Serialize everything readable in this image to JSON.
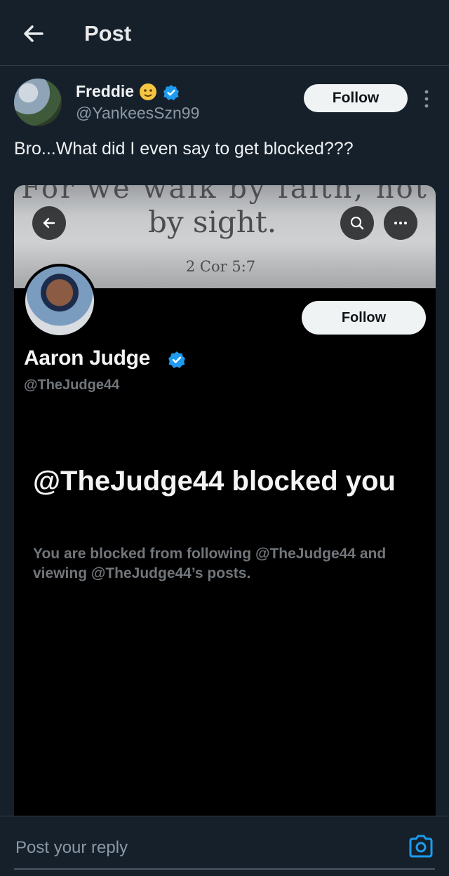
{
  "header": {
    "title": "Post"
  },
  "post": {
    "author_name": "Freddie",
    "author_handle": "@YankeesSzn99",
    "follow_label": "Follow",
    "text": "Bro...What did I even say to get blocked???"
  },
  "embedded_screenshot": {
    "banner_lines": [
      "For we walk by faith, not",
      "by sight.",
      "2 Cor 5:7"
    ],
    "profile_name": "Aaron Judge",
    "profile_handle": "@TheJudge44",
    "follow_label": "Follow",
    "blocked_title": "@TheJudge44 blocked you",
    "blocked_message": "You are blocked from following @TheJudge44 and viewing @TheJudge44’s posts."
  },
  "reply": {
    "placeholder": "Post your reply"
  },
  "colors": {
    "background": "#15202b",
    "verified": "#1d9bf0",
    "follow_button": "#eff3f4",
    "card_background": "#000000"
  },
  "icons": [
    "back-arrow-icon",
    "verified-badge-icon",
    "more-vertical-icon",
    "search-icon",
    "more-horizontal-icon",
    "camera-icon",
    "emoji-icon"
  ]
}
